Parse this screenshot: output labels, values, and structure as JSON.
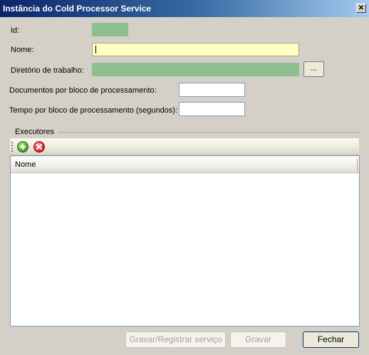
{
  "window": {
    "title": "Instância do Cold Processor Service",
    "close_glyph": "✕"
  },
  "form": {
    "id_label": "Id:",
    "id_value": "",
    "nome_label": "Nome:",
    "nome_value": "",
    "diretorio_label": "Diretório de trabalho:",
    "diretorio_value": "",
    "browse_label": "...",
    "documentos_label": "Documentos por bloco de processamento:",
    "documentos_value": "",
    "tempo_label": "Tempo por bloco de processamento (segundos):",
    "tempo_value": ""
  },
  "executores": {
    "group_label": "Executores",
    "toolbar": {
      "add_icon": "add-icon",
      "remove_icon": "remove-icon"
    },
    "columns": [
      "Nome"
    ],
    "rows": []
  },
  "footer": {
    "gravar_registrar_label": "Gravar/Registrar serviço",
    "gravar_label": "Gravar",
    "fechar_label": "Fechar"
  },
  "colors": {
    "title_gradient_start": "#0a246a",
    "readonly_field": "#8fbf8f",
    "focused_field": "#ffffc0",
    "background": "#d4d0c8"
  }
}
